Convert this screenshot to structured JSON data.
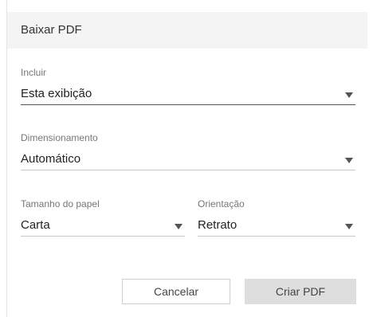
{
  "dialog": {
    "title": "Baixar PDF",
    "include": {
      "label": "Incluir",
      "value": "Esta exibição"
    },
    "scaling": {
      "label": "Dimensionamento",
      "value": "Automático"
    },
    "paper_size": {
      "label": "Tamanho do papel",
      "value": "Carta"
    },
    "orientation": {
      "label": "Orientação",
      "value": "Retrato"
    },
    "buttons": {
      "cancel": "Cancelar",
      "create": "Criar PDF"
    }
  },
  "icons": {
    "dropdown": "caret-down-icon"
  },
  "colors": {
    "header_bg": "#f4f4f4",
    "primary_button_bg": "#dedede",
    "active_underline": "#555555"
  }
}
